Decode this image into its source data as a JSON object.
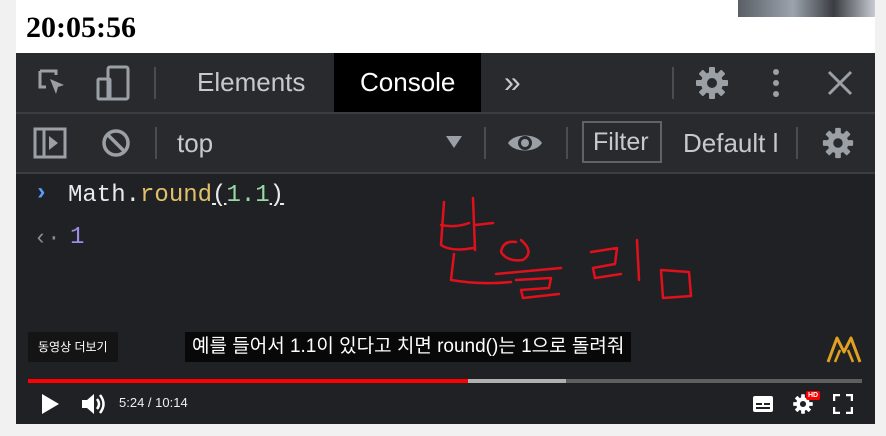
{
  "clock": "20:05:56",
  "devtools": {
    "tabs": {
      "elements": "Elements",
      "console": "Console",
      "more": "»"
    },
    "context": "top",
    "filter_placeholder": "Filter",
    "levels": "Default l"
  },
  "console": {
    "input_obj": "Math.",
    "input_fn": "round",
    "input_open": "(",
    "input_arg": "1.1",
    "input_close": ")",
    "result": "1"
  },
  "player": {
    "more_videos": "동영상 더보기",
    "caption": "예를 들어서 1.1이 있다고 치면 round()는 1으로 돌려줘",
    "time": "5:24 / 10:14",
    "hd_badge": "HD",
    "played_fraction": 0.528,
    "buffered_fraction": 0.645,
    "annotation_color": "#e0101c"
  }
}
